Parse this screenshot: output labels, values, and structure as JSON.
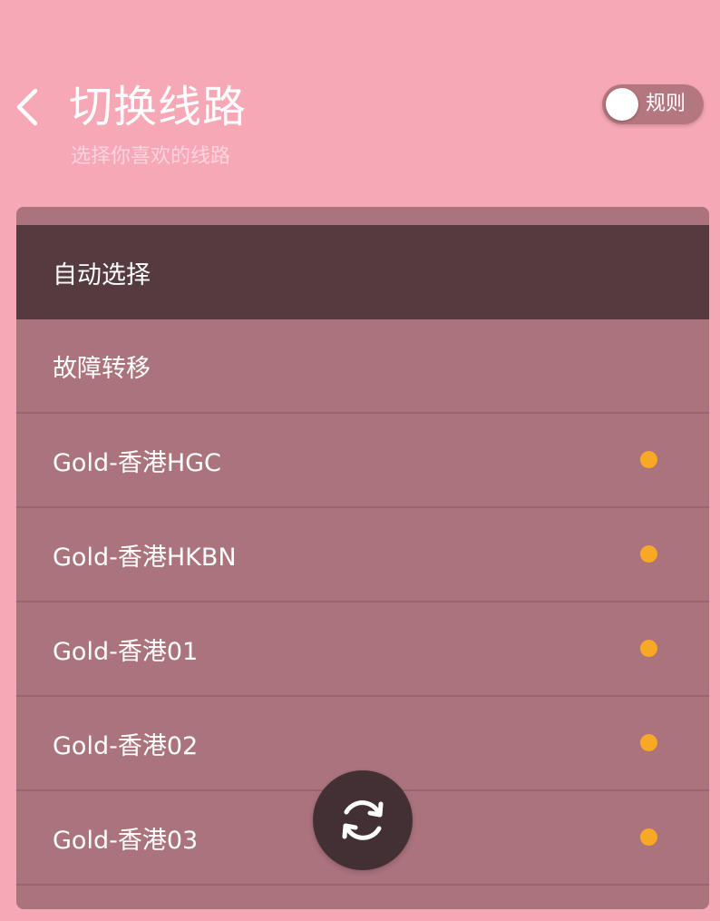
{
  "header": {
    "title": "切换线路",
    "subtitle": "选择你喜欢的线路",
    "rule_toggle_label": "规则",
    "rule_toggle_on": false
  },
  "routes": [
    {
      "name": "自动选择",
      "selected": true,
      "status": null
    },
    {
      "name": "故障转移",
      "selected": false,
      "status": null
    },
    {
      "name": "Gold-香港HGC",
      "selected": false,
      "status": "pending"
    },
    {
      "name": "Gold-香港HKBN",
      "selected": false,
      "status": "pending"
    },
    {
      "name": "Gold-香港01",
      "selected": false,
      "status": "pending"
    },
    {
      "name": "Gold-香港02",
      "selected": false,
      "status": "pending"
    },
    {
      "name": "Gold-香港03",
      "selected": false,
      "status": "pending"
    }
  ],
  "icons": {
    "back": "chevron-left-icon",
    "refresh": "refresh-icon"
  },
  "colors": {
    "background": "#f7a8b7",
    "panel": "#ab737c",
    "selected_row": "#553a40",
    "status_dot": "#f9a825",
    "refresh_button": "#433034"
  }
}
